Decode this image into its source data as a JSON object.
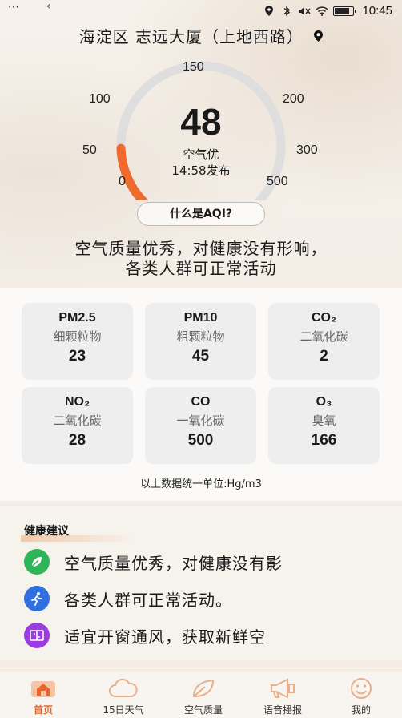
{
  "status_bar": {
    "dots": "···",
    "time": "10:45",
    "battery_level": 0.85
  },
  "location": {
    "text": "海淀区 志远大厦（上地西路）"
  },
  "gauge": {
    "value": "48",
    "level": "空气优",
    "published": "14:58发布",
    "min": 0,
    "max": 500,
    "current": 48,
    "ticks": [
      "0",
      "50",
      "100",
      "150",
      "200",
      "300",
      "500"
    ],
    "active_color": "#ee6a2e",
    "track_color": "#dedede"
  },
  "what_is_aqi": "什么是AQI?",
  "summary": {
    "line1": "空气质量优秀，对健康没有形响，",
    "line2": "各类人群可正常活动"
  },
  "pollutants": [
    {
      "name": "PM2.5",
      "cn": "细颗粒物",
      "value": "23"
    },
    {
      "name": "PM10",
      "cn": "粗颗粒物",
      "value": "45"
    },
    {
      "name": "CO₂",
      "cn": "二氧化碳",
      "value": "2"
    },
    {
      "name": "NO₂",
      "cn": "二氧化碳",
      "value": "28"
    },
    {
      "name": "CO",
      "cn": "一氧化碳",
      "value": "500"
    },
    {
      "name": "O₃",
      "cn": "臭氧",
      "value": "166"
    }
  ],
  "unit_note": "以上数据统一单位:Hg/m3",
  "health": {
    "title": "健康建议",
    "tips": [
      {
        "text": "空气质量优秀，对健康没有影",
        "icon": "leaf-icon",
        "color": "#2fb45a"
      },
      {
        "text": "各类人群可正常活动。",
        "icon": "running-icon",
        "color": "#2f6fe0"
      },
      {
        "text": "适宜开窗通风，获取新鲜空",
        "icon": "window-icon",
        "color": "#9a3de0"
      }
    ]
  },
  "nav": [
    {
      "label": "首页",
      "icon": "home-icon",
      "active": true
    },
    {
      "label": "15日天气",
      "icon": "cloud-icon",
      "active": false
    },
    {
      "label": "空气质量",
      "icon": "leaf-outline-icon",
      "active": false
    },
    {
      "label": "语音播报",
      "icon": "megaphone-icon",
      "active": false
    },
    {
      "label": "我的",
      "icon": "smiley-icon",
      "active": false
    }
  ],
  "accent_color": "#e8642a"
}
